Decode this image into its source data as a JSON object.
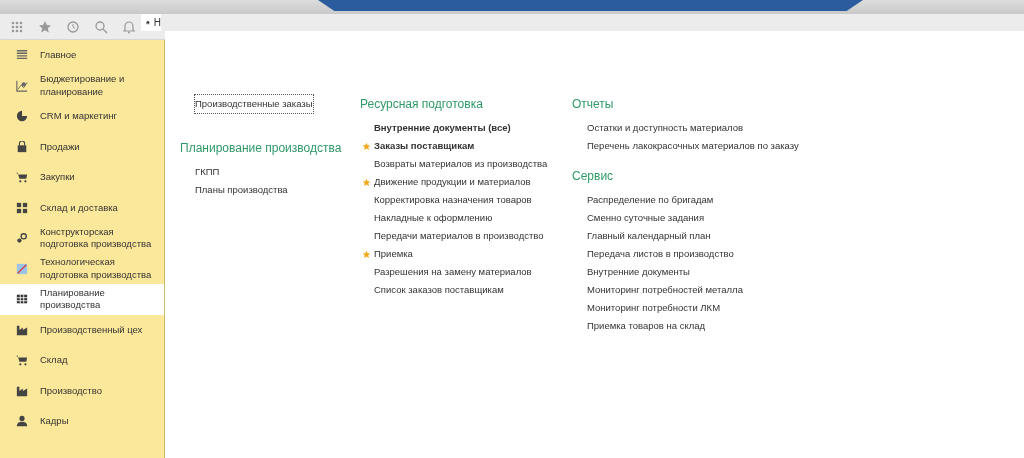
{
  "toolbar": {
    "home_tab": "Н"
  },
  "sidebar": {
    "items": [
      {
        "label": "Главное",
        "selected": false
      },
      {
        "label": "Бюджетирование и планирование",
        "selected": false
      },
      {
        "label": "CRM и маркетинг",
        "selected": false
      },
      {
        "label": "Продажи",
        "selected": false
      },
      {
        "label": "Закупки",
        "selected": false
      },
      {
        "label": "Склад и доставка",
        "selected": false
      },
      {
        "label": "Конструкторская подготовка производства",
        "selected": false
      },
      {
        "label": "Технологическая подготовка производства",
        "selected": false
      },
      {
        "label": "Планирование производства",
        "selected": true
      },
      {
        "label": "Производственный цех",
        "selected": false
      },
      {
        "label": "Склад",
        "selected": false
      },
      {
        "label": "Производство",
        "selected": false
      },
      {
        "label": "Кадры",
        "selected": false
      }
    ]
  },
  "columns": [
    [
      {
        "kind": "links",
        "items": [
          {
            "label": "Производственные заказы",
            "focused": true,
            "bold": false,
            "starred": false
          }
        ]
      },
      {
        "kind": "group",
        "title": "Планирование производства",
        "items": [
          {
            "label": "ГКПП",
            "focused": false,
            "bold": false,
            "starred": false
          },
          {
            "label": "Планы производства",
            "focused": false,
            "bold": false,
            "starred": false
          }
        ]
      }
    ],
    [
      {
        "kind": "group",
        "title": "Ресурсная подготовка",
        "items": [
          {
            "label": "Внутренние документы (все)",
            "focused": false,
            "bold": true,
            "starred": false
          },
          {
            "label": "Заказы поставщикам",
            "focused": false,
            "bold": true,
            "starred": true
          },
          {
            "label": "Возвраты материалов из производства",
            "focused": false,
            "bold": false,
            "starred": false
          },
          {
            "label": "Движение продукции и материалов",
            "focused": false,
            "bold": false,
            "starred": true
          },
          {
            "label": "Корректировка назначения товаров",
            "focused": false,
            "bold": false,
            "starred": false
          },
          {
            "label": "Накладные к оформлению",
            "focused": false,
            "bold": false,
            "starred": false
          },
          {
            "label": "Передачи материалов в производство",
            "focused": false,
            "bold": false,
            "starred": false
          },
          {
            "label": "Приемка",
            "focused": false,
            "bold": false,
            "starred": true
          },
          {
            "label": "Разрешения на замену материалов",
            "focused": false,
            "bold": false,
            "starred": false
          },
          {
            "label": "Список заказов поставщикам",
            "focused": false,
            "bold": false,
            "starred": false
          }
        ]
      }
    ],
    [
      {
        "kind": "group",
        "title": "Отчеты",
        "items": [
          {
            "label": "Остатки и доступность материалов",
            "focused": false,
            "bold": false,
            "starred": false
          },
          {
            "label": "Перечень лакокрасочных материалов по заказу",
            "focused": false,
            "bold": false,
            "starred": false
          }
        ]
      },
      {
        "kind": "group",
        "title": "Сервис",
        "items": [
          {
            "label": "Распределение по бригадам",
            "focused": false,
            "bold": false,
            "starred": false
          },
          {
            "label": "Сменно суточные задания",
            "focused": false,
            "bold": false,
            "starred": false
          },
          {
            "label": "Главный календарный план",
            "focused": false,
            "bold": false,
            "starred": false
          },
          {
            "label": "Передача листов в производство",
            "focused": false,
            "bold": false,
            "starred": false
          },
          {
            "label": "Внутренние документы",
            "focused": false,
            "bold": false,
            "starred": false
          },
          {
            "label": "Мониторинг потребностей металла",
            "focused": false,
            "bold": false,
            "starred": false
          },
          {
            "label": "Мониторинг потребности ЛКМ",
            "focused": false,
            "bold": false,
            "starred": false
          },
          {
            "label": "Приемка товаров на склад",
            "focused": false,
            "bold": false,
            "starred": false
          }
        ]
      }
    ]
  ]
}
